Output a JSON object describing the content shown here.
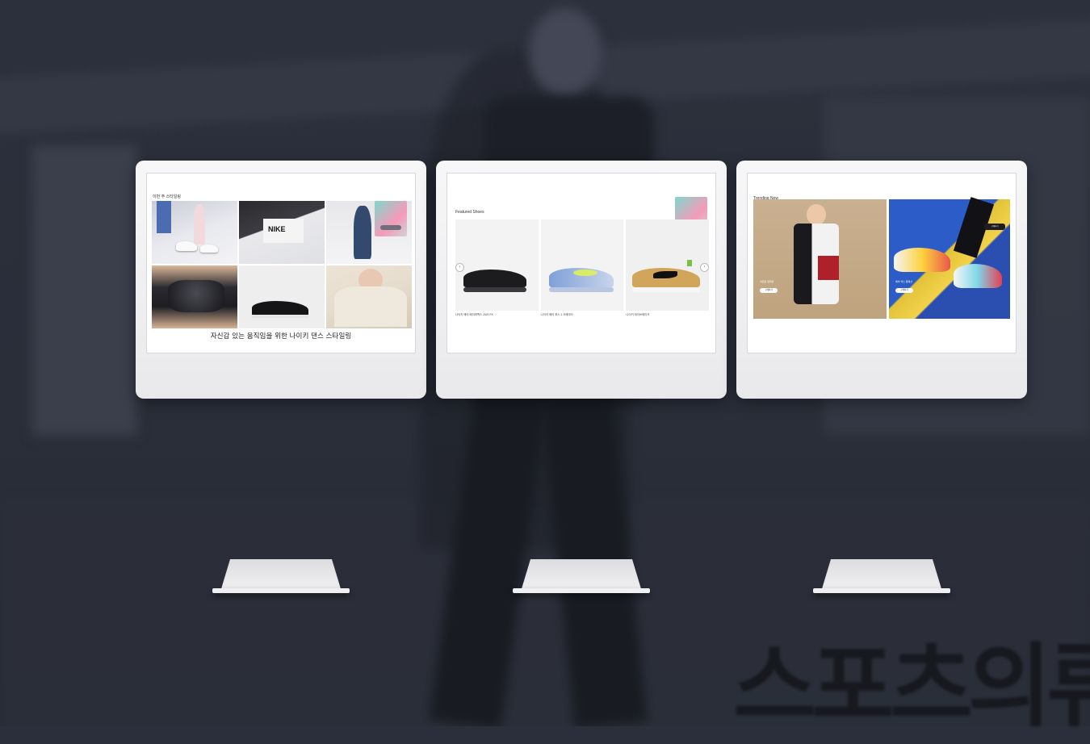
{
  "watermark": "스포츠의류",
  "monitor1": {
    "section_label": "이번 주 스타일링",
    "headline": "자신감 있는 움직임을 위한 나이키 댄스 스타일링",
    "promo": {
      "text": "",
      "button": ""
    }
  },
  "monitor2": {
    "section_label": "Featured Shoes",
    "products": [
      {
        "name": "나이키 에어 베이퍼맥스 2020 FK"
      },
      {
        "name": "나이키 에어 포스 1 크레이터"
      },
      {
        "name": "나이키 데이브레이크"
      }
    ]
  },
  "monitor3": {
    "section_label": "Trending Now",
    "cards": [
      {
        "label": "새로운 컬렉션",
        "button": "구매하기"
      },
      {
        "label": "에어 맥스 컬렉션",
        "button": "구매하기"
      }
    ],
    "promo_button": "구매하기"
  }
}
